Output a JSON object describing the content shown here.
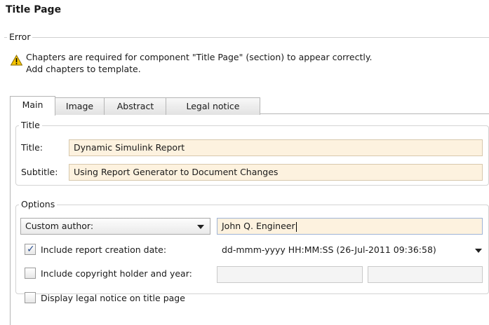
{
  "page": {
    "title": "Title Page"
  },
  "error": {
    "legend": "Error",
    "icon": "warning-icon",
    "line1": "Chapters are required for component \"Title Page\" (section) to appear correctly.",
    "line2": "Add chapters to template."
  },
  "tabs": [
    {
      "label": "Main",
      "active": true
    },
    {
      "label": "Image"
    },
    {
      "label": "Abstract"
    },
    {
      "label": "Legal notice"
    }
  ],
  "title_group": {
    "legend": "Title",
    "title_label": "Title:",
    "title_value": "Dynamic Simulink Report",
    "subtitle_label": "Subtitle:",
    "subtitle_value": "Using Report Generator to Document Changes"
  },
  "options": {
    "legend": "Options",
    "author_select": "Custom author:",
    "author_value": "John Q. Engineer",
    "include_date_label": "Include report creation date:",
    "include_date_checked": true,
    "date_format": "dd-mmm-yyyy HH:MM:SS (26-Jul-2011 09:36:58)",
    "copyright_label": "Include copyright holder and year:",
    "copyright_checked": false,
    "copyright_holder": "",
    "copyright_year": "",
    "legal_label": "Display legal notice on title page",
    "legal_checked": false
  },
  "colors": {
    "field_bg": "#fdf2df",
    "check": "#2b4f8f",
    "warning": "#f5c400"
  }
}
